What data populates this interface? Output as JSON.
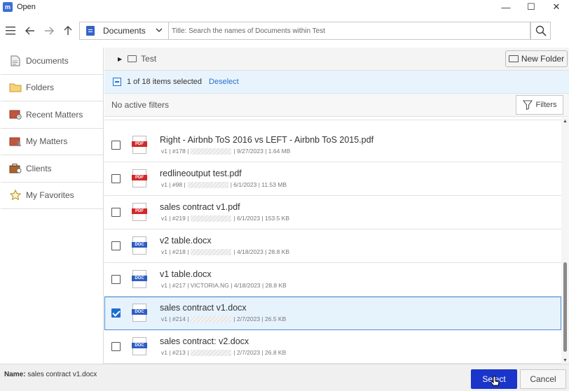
{
  "window": {
    "app_icon_text": "m",
    "title": "Open",
    "minimize": "—",
    "maximize": "☐",
    "close": "✕"
  },
  "toolbar": {
    "location_label": "Documents",
    "search_placeholder": "Title: Search the names of Documents within Test"
  },
  "sidebar": {
    "items": [
      {
        "label": "Documents",
        "icon": "document-icon"
      },
      {
        "label": "Folders",
        "icon": "folder-icon"
      },
      {
        "label": "Recent Matters",
        "icon": "recent-matters-icon"
      },
      {
        "label": "My Matters",
        "icon": "my-matters-icon"
      },
      {
        "label": "Clients",
        "icon": "clients-icon"
      },
      {
        "label": "My Favorites",
        "icon": "star-icon"
      }
    ]
  },
  "breadcrumb": {
    "label": "Test",
    "new_folder": "New Folder"
  },
  "selection": {
    "count_text": "1 of 18 items selected",
    "deselect": "Deselect"
  },
  "filters": {
    "status": "No active filters",
    "button": "Filters"
  },
  "files": [
    {
      "name": "Right - Airbnb ToS 2016 vs LEFT - Airbnb ToS 2015.pdf",
      "type": "PDF",
      "version": "v1",
      "number": "#178",
      "author": "",
      "date": "9/27/2023",
      "size": "1.64 MB",
      "checked": false
    },
    {
      "name": "redlineoutput test.pdf",
      "type": "PDF",
      "version": "v1",
      "number": "#98",
      "author": "",
      "date": "6/1/2023",
      "size": "11.53 MB",
      "checked": false
    },
    {
      "name": "sales contract v1.pdf",
      "type": "PDF",
      "version": "v1",
      "number": "#219",
      "author": "",
      "date": "6/1/2023",
      "size": "153.5 KB",
      "checked": false
    },
    {
      "name": "v2 table.docx",
      "type": "DOC",
      "version": "v1",
      "number": "#218",
      "author": "",
      "date": "4/18/2023",
      "size": "28.8 KB",
      "checked": false
    },
    {
      "name": "v1 table.docx",
      "type": "DOC",
      "version": "v1",
      "number": "#217",
      "author": "VICTORIA.NG",
      "date": "4/18/2023",
      "size": "28.8 KB",
      "checked": false
    },
    {
      "name": "sales contract v1.docx",
      "type": "DOC",
      "version": "v1",
      "number": "#214",
      "author": "",
      "date": "2/7/2023",
      "size": "26.5 KB",
      "checked": true
    },
    {
      "name": "sales contract: v2.docx",
      "type": "DOC",
      "version": "v1",
      "number": "#213",
      "author": "",
      "date": "2/7/2023",
      "size": "26.8 KB",
      "checked": false
    }
  ],
  "footer": {
    "name_label": "Name:",
    "name_value": "sales contract v1.docx",
    "select": "Select",
    "cancel": "Cancel"
  }
}
